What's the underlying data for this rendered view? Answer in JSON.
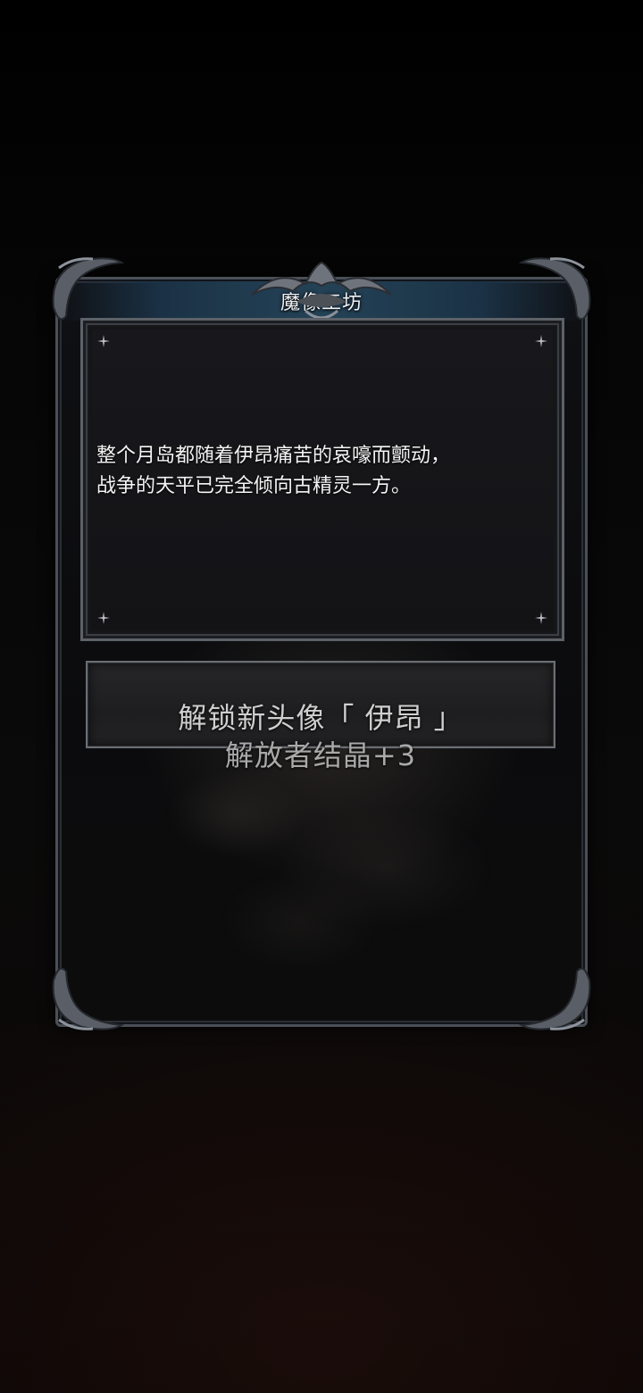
{
  "dialog": {
    "title": "魔像工坊"
  },
  "story": {
    "lines": [
      "整个月岛都随着伊昂痛苦的哀嚎而颤动，",
      "战争的天平已完全倾向古精灵一方。"
    ]
  },
  "reward": {
    "title": "解锁新头像「 伊昂 」",
    "subtitle": "解放者结晶+3"
  },
  "colors": {
    "frame": "#4a4f57",
    "title_bar": "#244256",
    "panel_bg": "#151518",
    "text": "#f4f4f4",
    "reward_text": "#cfcfcf"
  },
  "icons": {
    "corner": "ornate-corner-icon",
    "crest": "ornate-crest-icon",
    "sparkle": "sparkle-icon"
  }
}
